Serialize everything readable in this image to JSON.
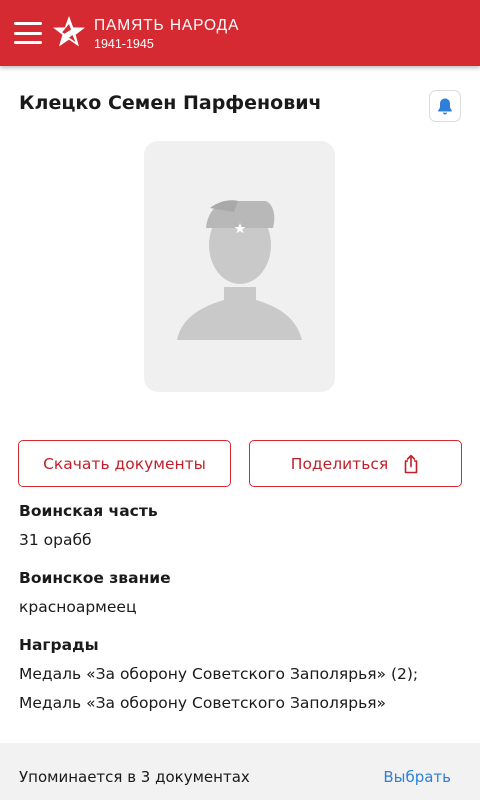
{
  "header": {
    "title": "ПАМЯТЬ НАРОДА",
    "years": "1941-1945",
    "menu_icon": "hamburger-menu-icon",
    "logo_icon": "red-star-logo-icon",
    "background_color": "#d62a32"
  },
  "person": {
    "name": "Клецко Семен Парфенович",
    "photo_placeholder_icon": "soldier-silhouette-icon",
    "subscribe_icon": "bell-icon"
  },
  "actions": {
    "download_label": "Скачать документы",
    "share_label": "Поделиться",
    "share_icon": "share-icon"
  },
  "details": [
    {
      "label": "Воинская часть",
      "value": "31 орабб"
    },
    {
      "label": "Воинское звание",
      "value": "красноармеец"
    },
    {
      "label": "Награды",
      "values": [
        "Медаль «За оборону Советского Заполярья» (2);",
        "Медаль «За оборону Советского Заполярья»"
      ]
    }
  ],
  "footer": {
    "mentions": "Упоминается в 3 документах",
    "choose_label": "Выбрать",
    "link_color": "#2f7fd9"
  }
}
